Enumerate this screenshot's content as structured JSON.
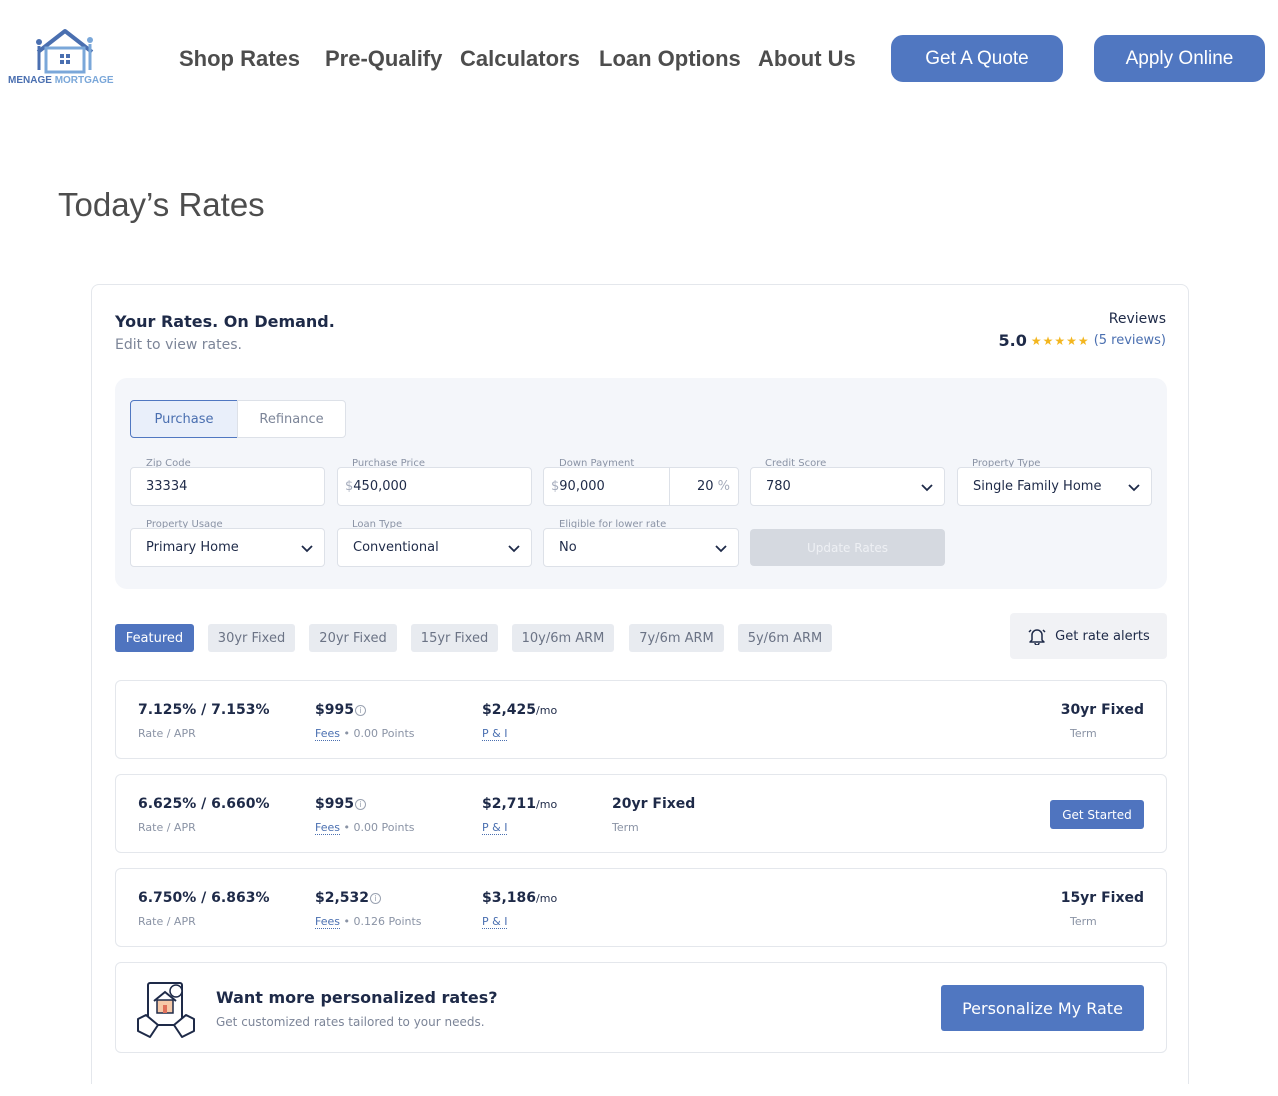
{
  "brand": {
    "logo_line1": "MENAGE",
    "logo_line2": "MORTGAGE",
    "accent_color": "#5077c1"
  },
  "nav": {
    "items": [
      "Shop Rates",
      "Pre-Qualify",
      "Calculators",
      "Loan Options",
      "About Us"
    ],
    "quote_button": "Get A Quote",
    "apply_button": "Apply Online"
  },
  "page_title": "Today’s Rates",
  "widget": {
    "title": "Your Rates. On Demand.",
    "subtitle": "Edit to view rates.",
    "reviews": {
      "label": "Reviews",
      "score": "5.0",
      "stars": "★★★★★",
      "count_text": "(5 reviews)"
    },
    "tabs": [
      "Purchase",
      "Refinance"
    ],
    "fields": {
      "zip": {
        "label": "Zip Code",
        "value": "33334"
      },
      "price": {
        "label": "Purchase Price",
        "prefix": "$",
        "value": "450,000"
      },
      "down": {
        "label": "Down Payment",
        "prefix": "$",
        "value": "90,000",
        "percent": "20",
        "percent_sign": "%"
      },
      "credit": {
        "label": "Credit Score",
        "value": "780"
      },
      "property_type": {
        "label": "Property Type",
        "value": "Single Family Home"
      },
      "usage": {
        "label": "Property Usage",
        "value": "Primary Home"
      },
      "loan_type": {
        "label": "Loan Type",
        "value": "Conventional"
      },
      "eligible": {
        "label": "Eligible for lower rate",
        "value": "No"
      }
    },
    "update_button": "Update Rates",
    "filters": [
      "Featured",
      "30yr Fixed",
      "20yr Fixed",
      "15yr Fixed",
      "10y/6m ARM",
      "7y/6m ARM",
      "5y/6m ARM"
    ],
    "alert_button": "Get rate alerts",
    "rate_labels": {
      "rate_apr": "Rate / APR",
      "fees": "Fees",
      "pi": "P & I",
      "term": "Term",
      "per_month": "/mo"
    },
    "rates": [
      {
        "rate_apr": "7.125% / 7.153%",
        "fee": "$995",
        "points": "• 0.00 Points",
        "payment": "$2,425",
        "term": "30yr Fixed"
      },
      {
        "rate_apr": "6.625% / 6.660%",
        "fee": "$995",
        "points": "• 0.00 Points",
        "payment": "$2,711",
        "term": "20yr Fixed",
        "cta": "Get Started"
      },
      {
        "rate_apr": "6.750% / 6.863%",
        "fee": "$2,532",
        "points": "• 0.126 Points",
        "payment": "$3,186",
        "term": "15yr Fixed"
      }
    ],
    "promo": {
      "title": "Want more personalized rates?",
      "subtitle": "Get customized rates tailored to your needs.",
      "button": "Personalize My Rate"
    }
  }
}
